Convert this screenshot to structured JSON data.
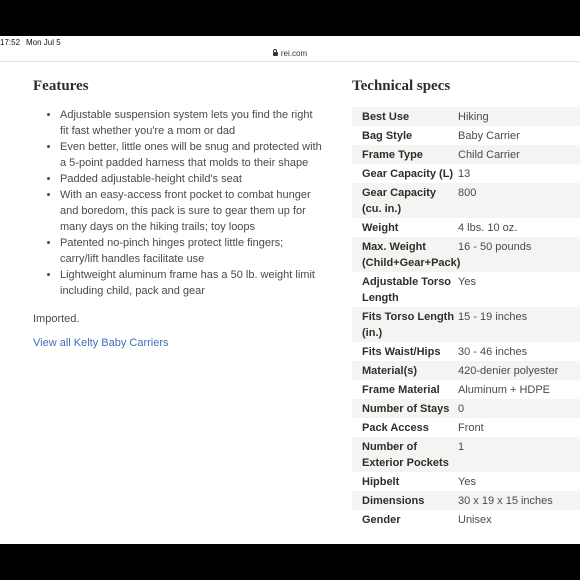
{
  "status_bar": {
    "time": "17:52",
    "date": "Mon Jul 5"
  },
  "browser": {
    "url": "rei.com"
  },
  "features": {
    "heading": "Features",
    "items": [
      "Adjustable suspension system lets you find the right fit fast whether you're a mom or dad",
      "Even better, little ones will be snug and protected with a 5-point padded harness that molds to their shape",
      "Padded adjustable-height child's seat",
      "With an easy-access front pocket to combat hunger and boredom, this pack is sure to gear them up for many days on the hiking trails; toy loops",
      "Patented no-pinch hinges protect little fingers; carry/lift handles facilitate use",
      "Lightweight aluminum frame has a 50 lb. weight limit including child, pack and gear"
    ],
    "imported": "Imported.",
    "view_all_link": "View all Kelty Baby Carriers"
  },
  "specs": {
    "heading": "Technical specs",
    "rows": [
      {
        "label": "Best Use",
        "value": "Hiking"
      },
      {
        "label": "Bag Style",
        "value": "Baby Carrier"
      },
      {
        "label": "Frame Type",
        "value": "Child Carrier"
      },
      {
        "label": "Gear Capacity (L)",
        "value": "13"
      },
      {
        "label": "Gear Capacity (cu. in.)",
        "value": "800"
      },
      {
        "label": "Weight",
        "value": "4 lbs. 10 oz."
      },
      {
        "label": "Max. Weight (Child+Gear+Pack)",
        "value": "16 - 50 pounds"
      },
      {
        "label": "Adjustable Torso Length",
        "value": "Yes"
      },
      {
        "label": "Fits Torso Length (in.)",
        "value": "15 - 19 inches"
      },
      {
        "label": "Fits Waist/Hips",
        "value": "30 - 46 inches"
      },
      {
        "label": "Material(s)",
        "value": "420-denier polyester"
      },
      {
        "label": "Frame Material",
        "value": "Aluminum + HDPE"
      },
      {
        "label": "Number of Stays",
        "value": "0"
      },
      {
        "label": "Pack Access",
        "value": "Front"
      },
      {
        "label": "Number of Exterior Pockets",
        "value": "1"
      },
      {
        "label": "Hipbelt",
        "value": "Yes"
      },
      {
        "label": "Dimensions",
        "value": "30 x 19 x 15 inches"
      },
      {
        "label": "Gender",
        "value": "Unisex"
      }
    ]
  }
}
